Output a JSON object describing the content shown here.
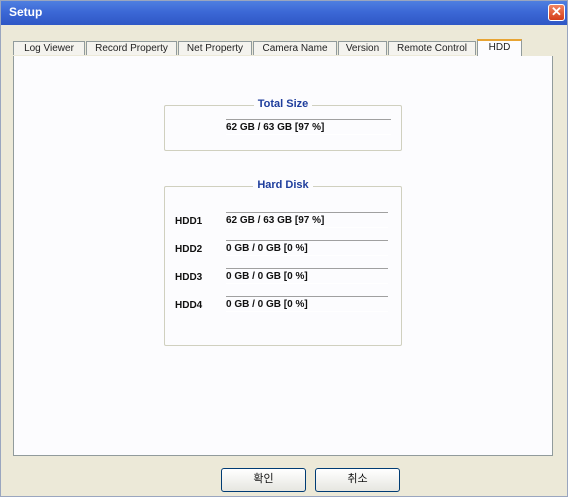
{
  "window": {
    "title": "Setup",
    "close_glyph": "✕"
  },
  "tabs": [
    {
      "label": "Log Viewer"
    },
    {
      "label": "Record Property"
    },
    {
      "label": "Net Property"
    },
    {
      "label": "Camera Name"
    },
    {
      "label": "Version"
    },
    {
      "label": "Remote Control"
    },
    {
      "label": "HDD",
      "active": true
    }
  ],
  "total_size": {
    "legend": "Total Size",
    "value": "62 GB / 63 GB [97 %]"
  },
  "hard_disk": {
    "legend": "Hard Disk",
    "disks": [
      {
        "label": "HDD1",
        "value": "62 GB / 63 GB [97 %]"
      },
      {
        "label": "HDD2",
        "value": "0 GB / 0 GB [0 %]"
      },
      {
        "label": "HDD3",
        "value": "0 GB / 0 GB [0 %]"
      },
      {
        "label": "HDD4",
        "value": "0 GB / 0 GB [0 %]"
      }
    ]
  },
  "buttons": {
    "ok": "확인",
    "cancel": "취소"
  }
}
